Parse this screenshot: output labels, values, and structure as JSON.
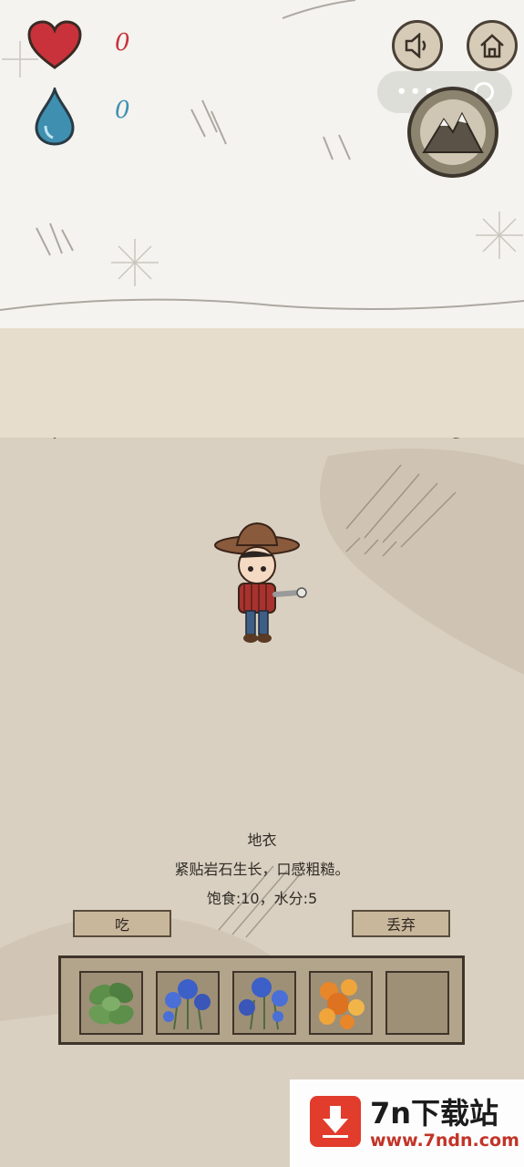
{
  "hud": {
    "health_value": "0",
    "water_value": "0"
  },
  "item": {
    "name": "地衣",
    "description": "紧贴岩石生长，口感粗糙。",
    "stats": "饱食:10，水分:5"
  },
  "actions": {
    "eat_label": "吃",
    "discard_label": "丢弃"
  },
  "inventory": {
    "slots": [
      {
        "icon": "mint-leaves-icon"
      },
      {
        "icon": "blue-cornflower-icon"
      },
      {
        "icon": "blue-cornflower-icon"
      },
      {
        "icon": "orange-lichen-icon"
      },
      {
        "icon": "empty-slot"
      }
    ]
  },
  "watermark": {
    "title": "7n下载站",
    "url": "www.7ndn.com"
  },
  "colors": {
    "heart": "#c9323a",
    "water": "#3f8fb1",
    "ground": "#d9d0c1"
  }
}
